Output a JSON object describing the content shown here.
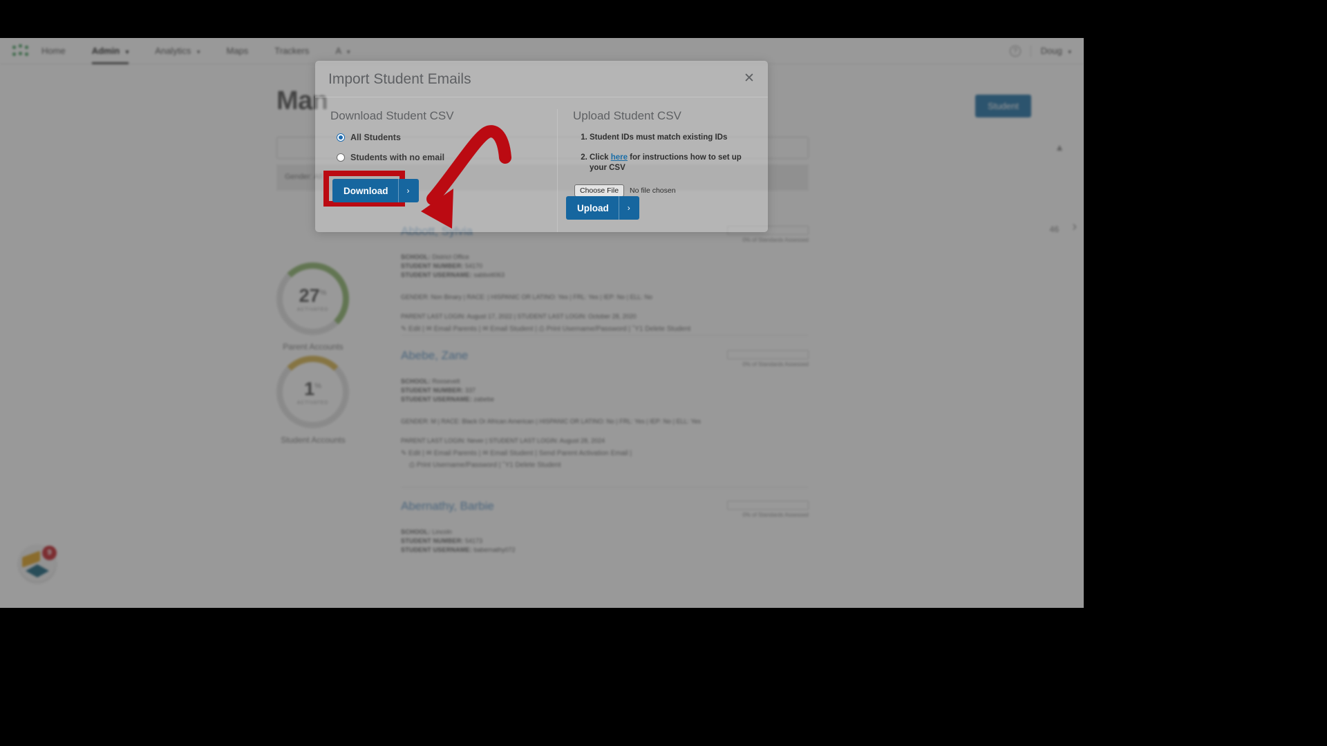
{
  "app": {
    "nav": {
      "logo_icon": "app-logo-dots-icon",
      "items": [
        {
          "label": "Home",
          "has_caret": false,
          "active": false
        },
        {
          "label": "Admin",
          "has_caret": true,
          "active": true
        },
        {
          "label": "Analytics",
          "has_caret": true,
          "active": false
        },
        {
          "label": "Maps",
          "has_caret": false,
          "active": false
        },
        {
          "label": "Trackers",
          "has_caret": false,
          "active": false
        },
        {
          "label": "A",
          "has_caret": true,
          "active": false
        }
      ],
      "help_icon": "help-question-icon",
      "user_name": "Doug",
      "user_caret": "▾"
    },
    "page": {
      "title": "Man",
      "add_student_label": "Student",
      "search_placeholder": "",
      "filter_label": "Gender: All",
      "collapse_icon": "chevron-up-icon",
      "pager_count": "46",
      "pager_next_icon": "chevron-right-icon"
    },
    "gauges": [
      {
        "value": "27",
        "unit": "%",
        "state": "ACTIVATED",
        "caption": "Parent Accounts",
        "pct": 27,
        "color": "#8cb56b"
      },
      {
        "value": "1",
        "unit": "%",
        "state": "ACTIVATED",
        "caption": "Student Accounts",
        "pct": 1,
        "color": "#d8b34a"
      }
    ],
    "students": [
      {
        "name": "Abbott, Sylvia",
        "school_label": "SCHOOL:",
        "school": "District Office",
        "number_label": "STUDENT NUMBER:",
        "number": "54170",
        "username_label": "STUDENT USERNAME:",
        "username": "sabbott063",
        "demographics": "GENDER: Non Binary  |  RACE:  |  HISPANIC OR LATINO: Yes  |  FRL: Yes  |  IEP: No  |  ELL: No",
        "logins": "PARENT LAST LOGIN: August 17, 2022  |  STUDENT LAST LOGIN: October 28, 2020",
        "actions": "✎ Edit  |  ✉ Email Parents  |  ✉ Email Student  |  ⎙ Print Username/Password  |  Ὕ1 Delete Student",
        "bar_label": "0% of Standards Assessed"
      },
      {
        "name": "Abebe, Zane",
        "school_label": "SCHOOL:",
        "school": "Roosevelt",
        "number_label": "STUDENT NUMBER:",
        "number": "337",
        "username_label": "STUDENT USERNAME:",
        "username": "zabebe",
        "demographics": "GENDER: M  |  RACE: Black Or African American  |  HISPANIC OR LATINO: No  |  FRL: Yes  |  IEP: No  |  ELL: Yes",
        "logins": "PARENT LAST LOGIN: Never  |  STUDENT LAST LOGIN: August 28, 2024",
        "actions": "✎ Edit  |  ✉ Email Parents  |  ✉ Email Student  |  Send Parent Activation Email  |",
        "actions2": "⎙ Print Username/Password  |  Ὕ1 Delete Student",
        "bar_label": "0% of Standards Assessed"
      },
      {
        "name": "Abernathy, Barbie",
        "school_label": "SCHOOL:",
        "school": "Lincoln",
        "number_label": "STUDENT NUMBER:",
        "number": "54173",
        "username_label": "STUDENT USERNAME:",
        "username": "babernathy072",
        "demographics": "",
        "logins": "",
        "actions": "",
        "bar_label": "0% of Standards Assessed"
      }
    ],
    "helper_widget": {
      "icon": "resource-center-diamond-icon",
      "badge_count": "9"
    }
  },
  "modal": {
    "title": "Import Student Emails",
    "close_icon": "close-x-icon",
    "download": {
      "heading": "Download Student CSV",
      "options": [
        {
          "label": "All Students",
          "selected": true
        },
        {
          "label": "Students with no email",
          "selected": false
        }
      ],
      "button_label": "Download",
      "button_arrow": "›",
      "highlight_color": "#bb0a12"
    },
    "upload": {
      "heading": "Upload Student CSV",
      "instructions": [
        {
          "index": "1.",
          "pre": "Student IDs must match existing IDs",
          "link": "",
          "post": ""
        },
        {
          "index": "2.",
          "pre": "Click ",
          "link": "here",
          "post": " for instructions how to set up your CSV"
        }
      ],
      "choose_file_label": "Choose File",
      "no_file_label": "No file chosen",
      "button_label": "Upload",
      "button_arrow": "›"
    }
  },
  "annotation": {
    "arrow_color": "#bb0a12",
    "arrow_name": "red-callout-arrow"
  }
}
